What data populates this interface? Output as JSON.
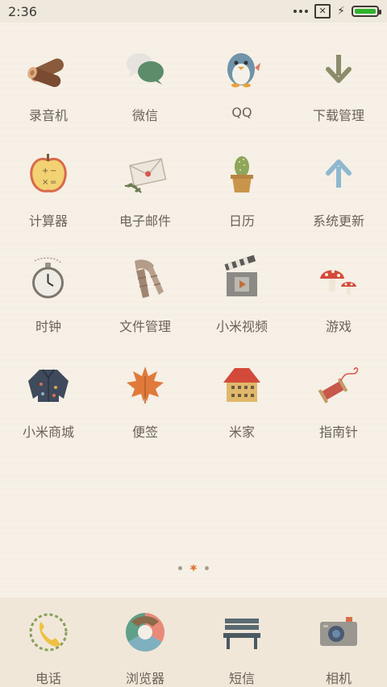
{
  "status_bar": {
    "time": "2:36",
    "bolt": "⚡",
    "box_x": "✕"
  },
  "apps": [
    {
      "label": "录音机",
      "icon": "logs-icon"
    },
    {
      "label": "微信",
      "icon": "chat-bubbles-icon"
    },
    {
      "label": "QQ",
      "icon": "penguin-icon"
    },
    {
      "label": "下载管理",
      "icon": "down-arrow-icon"
    },
    {
      "label": "计算器",
      "icon": "apple-calculator-icon"
    },
    {
      "label": "电子邮件",
      "icon": "envelope-icon"
    },
    {
      "label": "日历",
      "icon": "cactus-icon"
    },
    {
      "label": "系统更新",
      "icon": "up-arrow-icon"
    },
    {
      "label": "时钟",
      "icon": "pocket-watch-icon"
    },
    {
      "label": "文件管理",
      "icon": "scarf-icon"
    },
    {
      "label": "小米视频",
      "icon": "clapperboard-icon"
    },
    {
      "label": "游戏",
      "icon": "mushroom-icon"
    },
    {
      "label": "小米商城",
      "icon": "sweater-icon"
    },
    {
      "label": "便签",
      "icon": "maple-leaf-icon"
    },
    {
      "label": "米家",
      "icon": "house-icon"
    },
    {
      "label": "指南针",
      "icon": "spool-icon"
    }
  ],
  "dock": [
    {
      "label": "电话",
      "icon": "phone-wreath-icon"
    },
    {
      "label": "浏览器",
      "icon": "color-wheel-icon"
    },
    {
      "label": "短信",
      "icon": "bench-icon"
    },
    {
      "label": "相机",
      "icon": "camera-icon"
    }
  ],
  "colors": {
    "background": "#f6f0e6",
    "dock": "#f0e7d9",
    "label": "#6b6259",
    "battery": "#2fb32f"
  }
}
